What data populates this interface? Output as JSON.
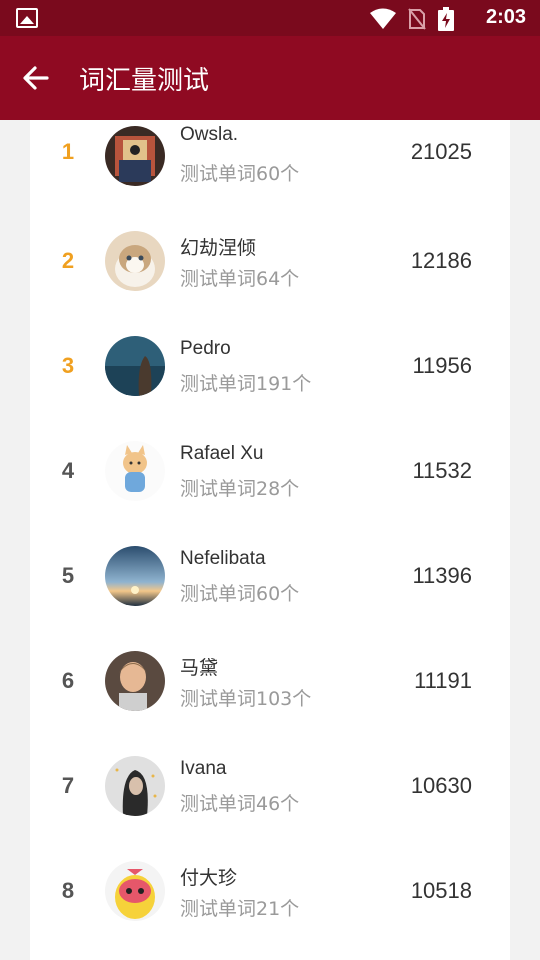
{
  "status_bar": {
    "time": "2:03",
    "icons": [
      "image-icon",
      "wifi-icon",
      "no-sim-icon",
      "battery-charging-icon"
    ]
  },
  "header": {
    "title": "词汇量测试",
    "back_icon": "arrow-left-icon"
  },
  "colors": {
    "status_bar": "#7a0a1d",
    "app_bar": "#8f0a22",
    "top_rank": "#f0a020",
    "rank": "#555555"
  },
  "leaderboard": [
    {
      "rank": "1",
      "name": "Owsla.",
      "subtitle": "测试单词60个",
      "score": "21025"
    },
    {
      "rank": "2",
      "name": "幻劫涅倾",
      "subtitle": "测试单词64个",
      "score": "12186"
    },
    {
      "rank": "3",
      "name": "Pedro",
      "subtitle": "测试单词191个",
      "score": "11956"
    },
    {
      "rank": "4",
      "name": "Rafael Xu",
      "subtitle": "测试单词28个",
      "score": "11532"
    },
    {
      "rank": "5",
      "name": "Nefelibata",
      "subtitle": "测试单词60个",
      "score": "11396"
    },
    {
      "rank": "6",
      "name": "马黛",
      "subtitle": "测试单词103个",
      "score": "11191"
    },
    {
      "rank": "7",
      "name": "Ivana",
      "subtitle": "测试单词46个",
      "score": "10630"
    },
    {
      "rank": "8",
      "name": "付大珍",
      "subtitle": "测试单词21个",
      "score": "10518"
    }
  ]
}
